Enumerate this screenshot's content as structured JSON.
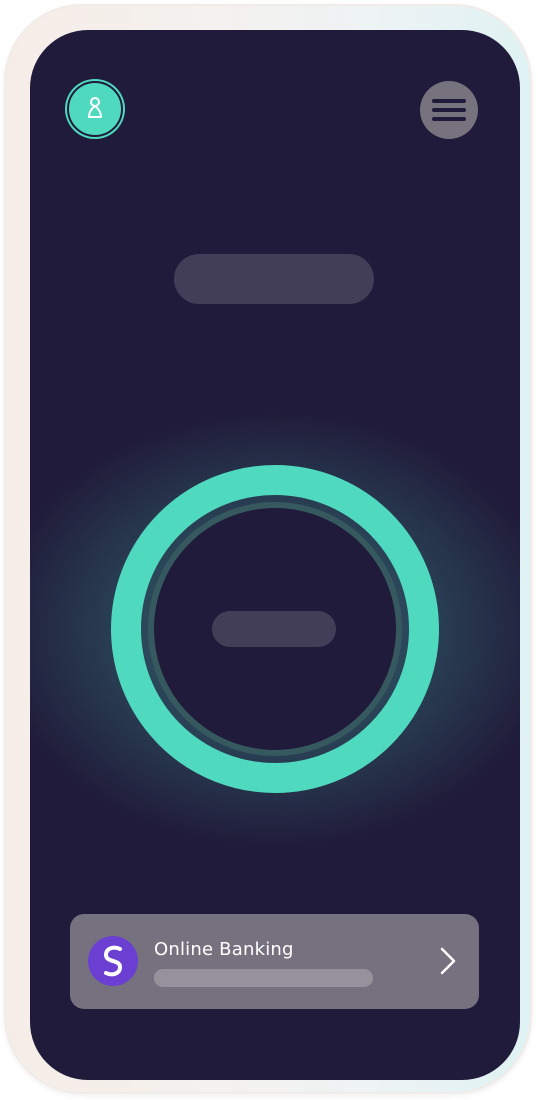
{
  "header": {
    "profile_icon": "person-icon",
    "menu_icon": "hamburger-menu-icon"
  },
  "banking_card": {
    "label": "Online Banking",
    "logo_icon": "bank-logo-icon",
    "chevron_icon": "chevron-right-icon"
  },
  "colors": {
    "background": "#201b3a",
    "accent": "#4fd9bf",
    "card": "#76717f",
    "brand_purple": "#6a3fd1"
  }
}
